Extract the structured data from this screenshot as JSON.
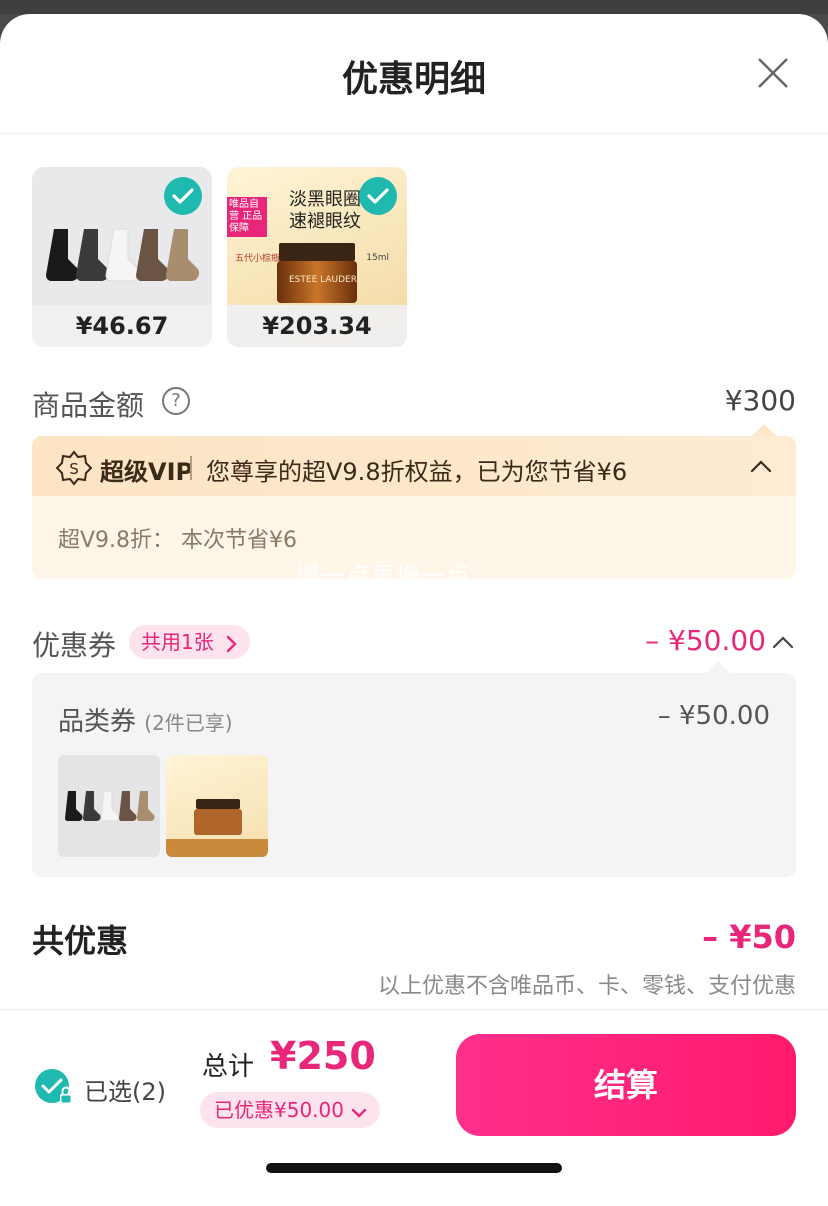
{
  "header": {
    "title": "优惠明细"
  },
  "products": [
    {
      "price": "¥46.67",
      "name": "socks"
    },
    {
      "price": "¥203.34",
      "name": "eye-cream",
      "tag_line1": "淡黑眼圈",
      "tag_line2": "速褪眼纹",
      "brand": "ESTEE LAUDER",
      "badge": "唯品自营 正品保障",
      "size": "15ml",
      "crown": "五代小棕瓶"
    }
  ],
  "amount": {
    "label": "商品金额",
    "value": "¥300"
  },
  "vip": {
    "title": "超级VIP",
    "desc": "您尊享的超V9.8折权益，已为您节省¥6",
    "detail": "超V9.8折：  本次节省¥6",
    "watermark": "慢一点再慢一点"
  },
  "coupon": {
    "label": "优惠券",
    "pill": "共用1张",
    "total": "– ¥50.00",
    "category_label": "品类券",
    "category_sub": "(2件已享)",
    "category_value": "– ¥50.00"
  },
  "summary": {
    "label": "共优惠",
    "value": "– ¥50",
    "note": "以上优惠不含唯品币、卡、零钱、支付优惠"
  },
  "bottom": {
    "selected": "已选(2)",
    "total_label": "总计",
    "total_value": "¥250",
    "saved": "已优惠¥50.00",
    "checkout": "结算"
  },
  "colors": {
    "accent": "#e8277a",
    "check": "#1fb9b0",
    "vip_bg": "#fde4c4"
  }
}
